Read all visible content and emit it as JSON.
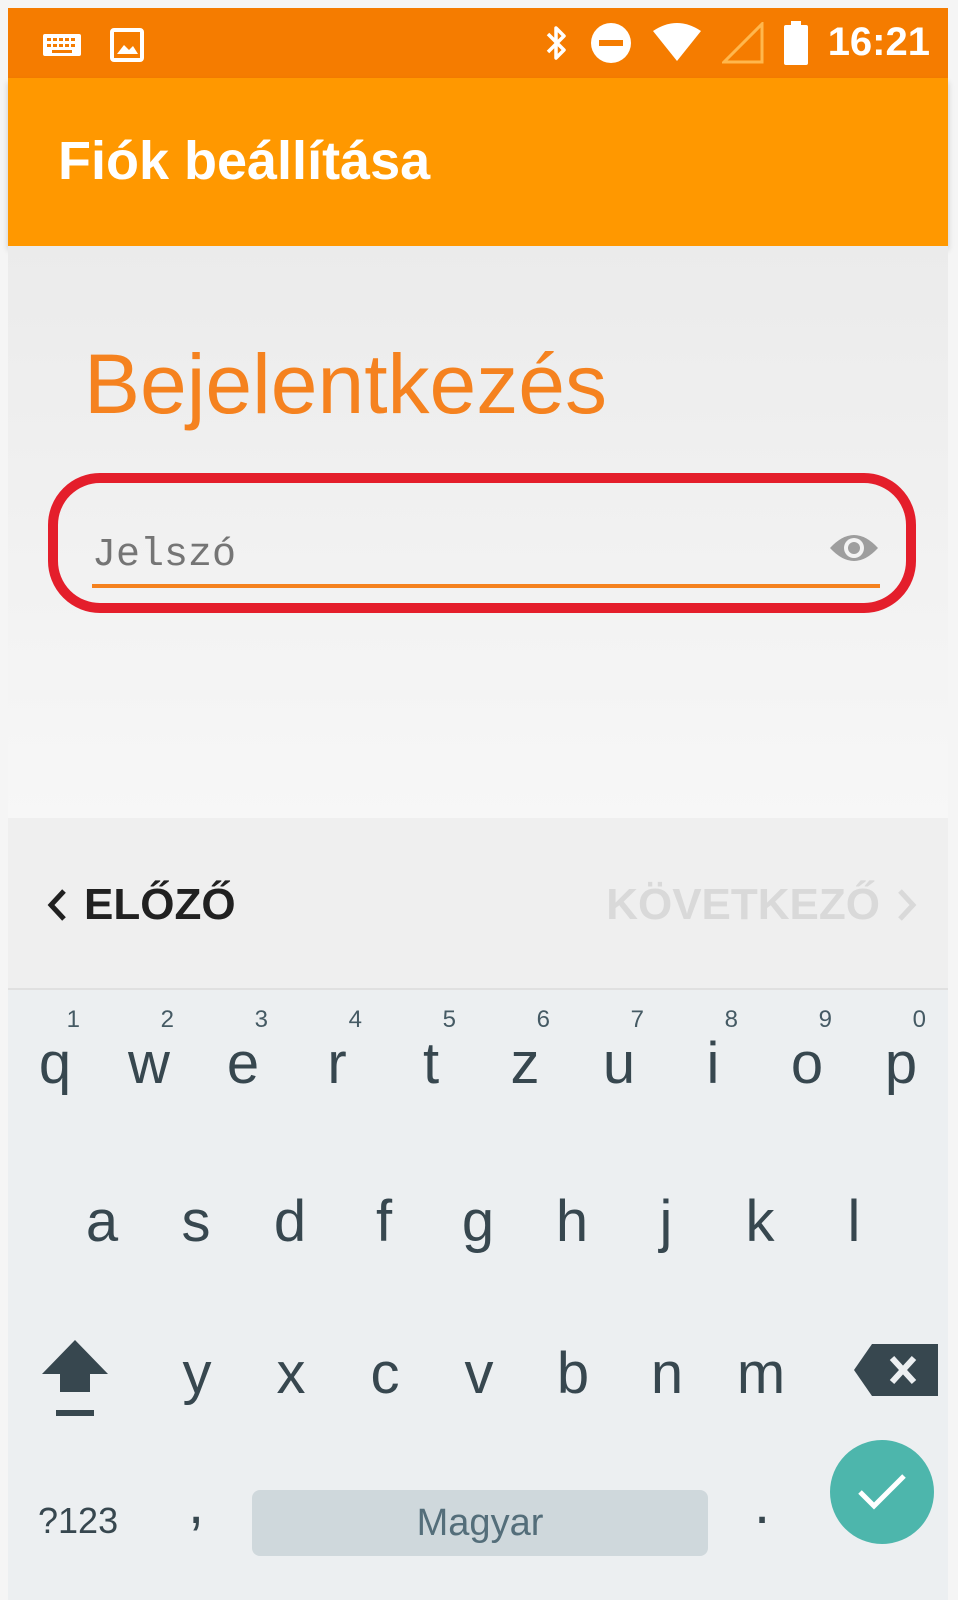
{
  "status_bar": {
    "time": "16:21",
    "icons": [
      "keyboard-icon",
      "image-icon",
      "bluetooth-icon",
      "do-not-disturb-icon",
      "wifi-icon",
      "signal-icon",
      "battery-icon"
    ]
  },
  "app_bar": {
    "title": "Fiók beállítása"
  },
  "form": {
    "heading": "Bejelentkezés",
    "password_placeholder": "Jelszó",
    "password_value": "",
    "accent_color": "#f5821f",
    "highlight_color": "#e41e2b"
  },
  "navigation": {
    "prev_label": "ELŐZŐ",
    "next_label": "KÖVETKEZŐ"
  },
  "keyboard": {
    "row1": [
      {
        "letter": "q",
        "hint": "1"
      },
      {
        "letter": "w",
        "hint": "2"
      },
      {
        "letter": "e",
        "hint": "3"
      },
      {
        "letter": "r",
        "hint": "4"
      },
      {
        "letter": "t",
        "hint": "5"
      },
      {
        "letter": "z",
        "hint": "6"
      },
      {
        "letter": "u",
        "hint": "7"
      },
      {
        "letter": "i",
        "hint": "8"
      },
      {
        "letter": "o",
        "hint": "9"
      },
      {
        "letter": "p",
        "hint": "0"
      }
    ],
    "row2": [
      "a",
      "s",
      "d",
      "f",
      "g",
      "h",
      "j",
      "k",
      "l"
    ],
    "row3": [
      "y",
      "x",
      "c",
      "v",
      "b",
      "n",
      "m"
    ],
    "symbols_label": "?123",
    "comma": ",",
    "space_label": "Magyar",
    "period": "."
  }
}
